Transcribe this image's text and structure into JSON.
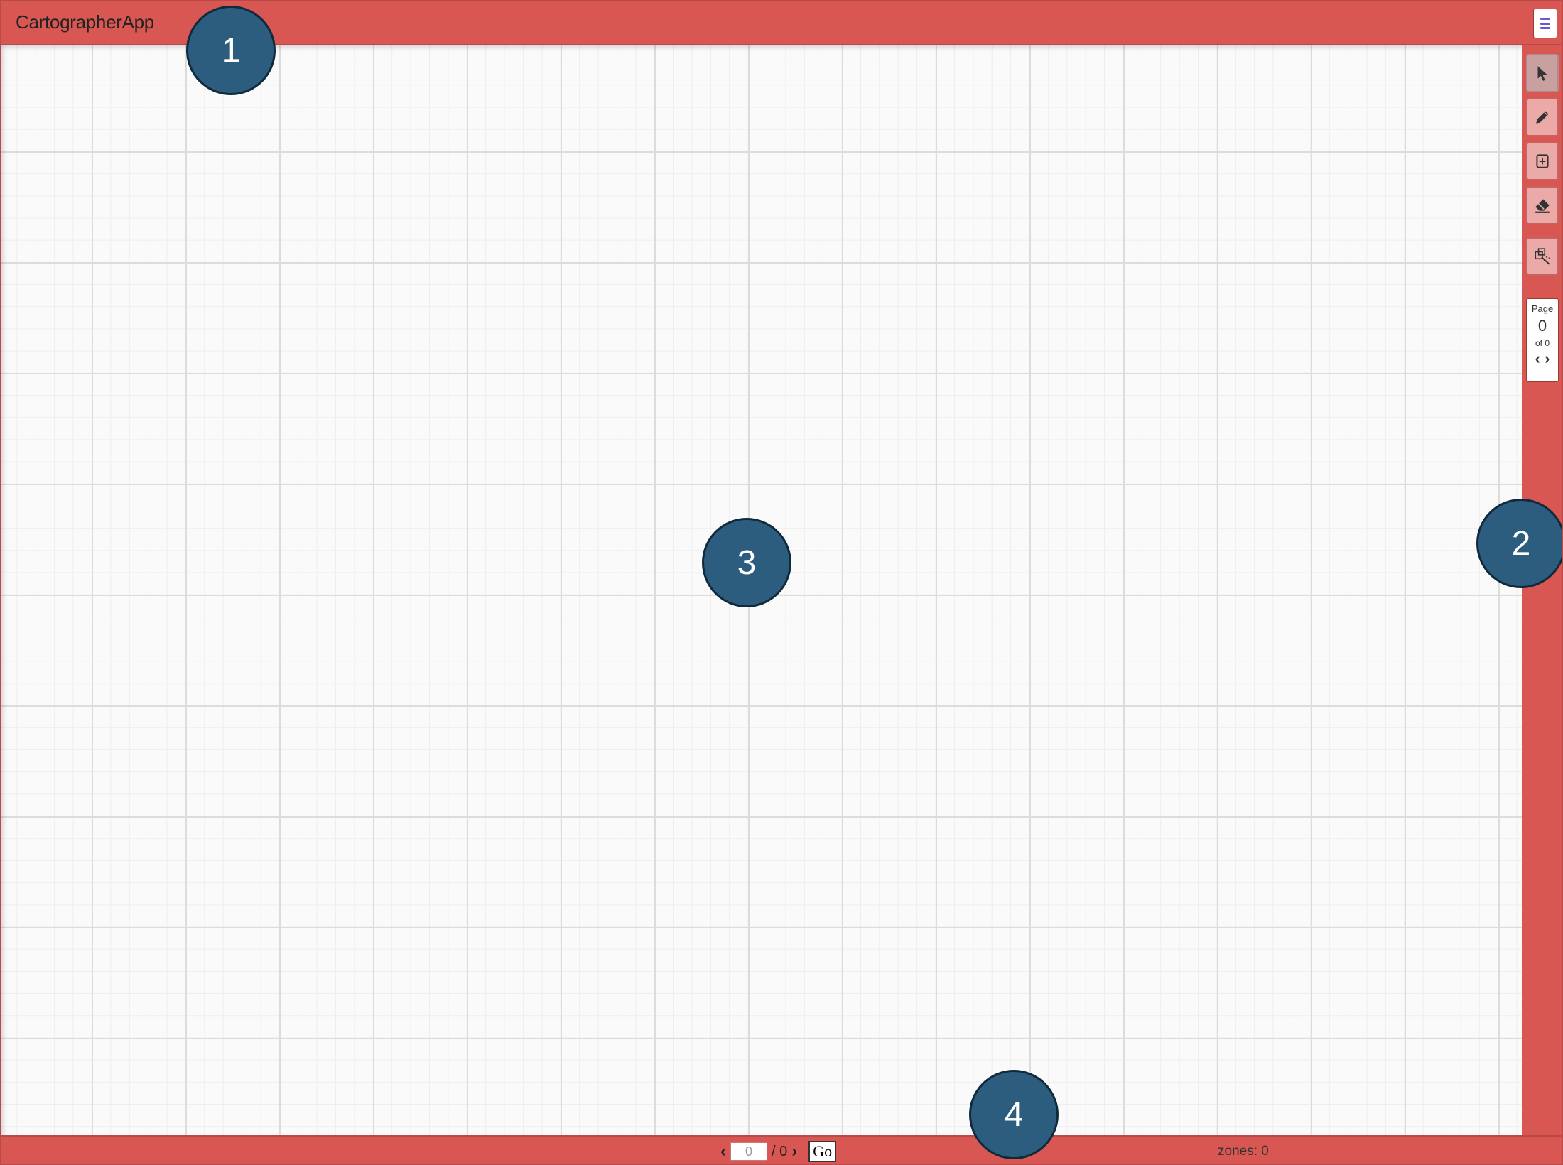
{
  "header": {
    "title": "CartographerApp"
  },
  "toolbar": {
    "tools": [
      {
        "name": "select-tool",
        "icon": "pointer-arrow-icon",
        "active": true
      },
      {
        "name": "draw-tool",
        "icon": "pencil-icon"
      },
      {
        "name": "add-zone-tool",
        "icon": "plus-square-icon"
      },
      {
        "name": "erase-tool",
        "icon": "eraser-icon"
      },
      {
        "name": "magic-select-tool",
        "icon": "lasso-wand-icon"
      }
    ],
    "page": {
      "label": "Page",
      "current": "0",
      "of_label": "of 0",
      "prev": "‹",
      "next": "›"
    }
  },
  "footer": {
    "prev": "‹",
    "page_value": "0",
    "total": "/ 0",
    "next": "›",
    "go_label": "Go",
    "zones_label": "zones: 0"
  },
  "annotations": [
    "1",
    "2",
    "3",
    "4"
  ],
  "colors": {
    "accent": "#d95752",
    "badge": "#2c5d7e",
    "grid": "#dcdcdc"
  }
}
